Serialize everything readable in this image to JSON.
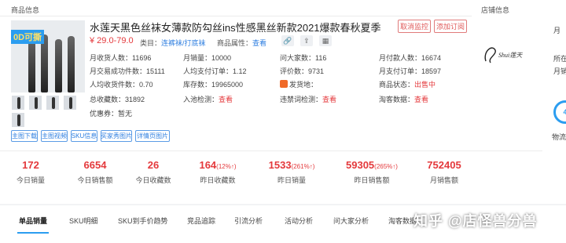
{
  "sections": {
    "product_info": "商品信息",
    "store_info": "店铺信息"
  },
  "product": {
    "image_badge": "0D可撕",
    "title": "水莲天黑色丝袜女薄款防勾丝ins性感黑丝新款2021爆款春秋夏季",
    "price": "¥ 29.0-79.0",
    "category_label": "类目：",
    "category_value": "连裤袜/打底袜",
    "attributes_label": "商品属性：",
    "attributes_link": "查看"
  },
  "buttons": {
    "cancel_monitor": "取消监控",
    "add_subscription": "添加订阅"
  },
  "metrics": [
    {
      "label": "月收货人数：",
      "value": "11696"
    },
    {
      "label": "月销量：",
      "value": "10000"
    },
    {
      "label": "问大家数：",
      "value": "116"
    },
    {
      "label": "月付款人数：",
      "value": "16674"
    },
    {
      "label": "月交易成功件数：",
      "value": "15111"
    },
    {
      "label": "人均支付订单：",
      "value": "1.12"
    },
    {
      "label": "评价数：",
      "value": "9731"
    },
    {
      "label": "月支付订单：",
      "value": "18597"
    },
    {
      "label": "人均收货件数：",
      "value": "0.70"
    },
    {
      "label": "库存数：",
      "value": "19965000"
    },
    {
      "label": "发货地：",
      "value": ""
    },
    {
      "label": "商品状态：",
      "value": "出售中"
    },
    {
      "label": "总收藏数：",
      "value": "31892"
    },
    {
      "label": "入池检测：",
      "value": "查看"
    },
    {
      "label": "违禁词检测：",
      "value": "查看"
    },
    {
      "label": "淘客数据：",
      "value": "查看"
    }
  ],
  "coupon": {
    "label": "优惠券：",
    "value": "暂无"
  },
  "actions": [
    "主图下载",
    "主图视频",
    "SKU信息",
    "买家秀图片",
    "详情页图片"
  ],
  "store": {
    "logo_text": "Shui莲天",
    "lines": [
      "月",
      "所在",
      "月销"
    ],
    "circle_value": "4",
    "circle_label": "物流"
  },
  "stats": [
    {
      "value": "172",
      "change": "",
      "label": "今日销量"
    },
    {
      "value": "6654",
      "change": "",
      "label": "今日销售额"
    },
    {
      "value": "26",
      "change": "",
      "label": "今日收藏数"
    },
    {
      "value": "164",
      "change": "(12%↑)",
      "label": "昨日收藏数"
    },
    {
      "value": "1533",
      "change": "(261%↑)",
      "label": "昨日销量"
    },
    {
      "value": "59305",
      "change": "(265%↑)",
      "label": "昨日销售额"
    },
    {
      "value": "752405",
      "change": "",
      "label": "月销售额"
    }
  ],
  "tabs": [
    "单品销量",
    "SKU明细",
    "SKU到手价趋势",
    "竞品追踪",
    "引流分析",
    "活动分析",
    "问大家分析",
    "淘客数据"
  ],
  "watermark": "知乎 @店怪兽分兽",
  "colors": {
    "accent_red": "#e4393c",
    "accent_blue": "#2b9df0"
  }
}
